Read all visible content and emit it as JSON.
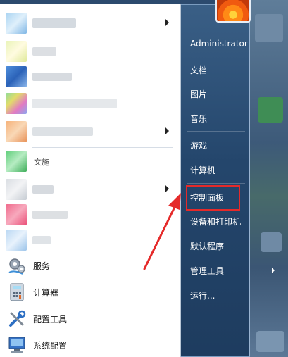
{
  "user": {
    "name": "Administrator"
  },
  "right_menu": {
    "items": [
      "文档",
      "图片",
      "音乐",
      "游戏",
      "计算机",
      "控制面板",
      "设备和打印机",
      "默认程序",
      "管理工具",
      "运行..."
    ]
  },
  "left_menu": {
    "pinned": [
      {
        "label": "服务",
        "icon": "services-gear-icon"
      },
      {
        "label": "计算器",
        "icon": "calculator-icon"
      },
      {
        "label": "配置工具",
        "icon": "tools-icon"
      },
      {
        "label": "系统配置",
        "icon": "system-config-icon"
      }
    ],
    "partial_label": "文施"
  },
  "annotation": {
    "highlight_color": "#e52a2a",
    "target": "控制面板"
  }
}
